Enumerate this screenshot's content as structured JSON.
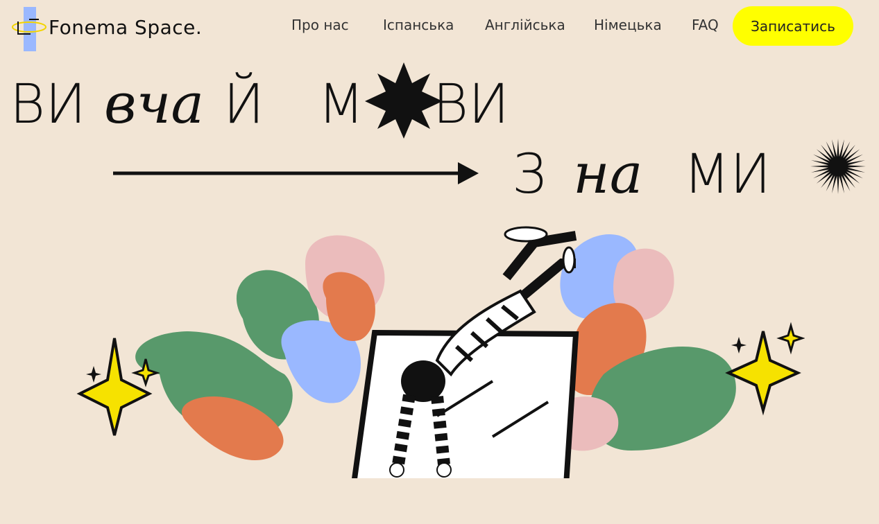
{
  "brand": {
    "name": "Fonema Space.",
    "accent_yellow": "#ffff00",
    "accent_blue": "#9ab8ff"
  },
  "nav": {
    "items": [
      {
        "label": "Про нас"
      },
      {
        "label": "Іспанська"
      },
      {
        "label": "Англійська"
      },
      {
        "label": "Німецька"
      },
      {
        "label": "FAQ"
      }
    ],
    "cta_label": "Записатись"
  },
  "hero": {
    "line1_part_a": "ВИ",
    "line1_part_b": "вча",
    "line1_part_c": "Й",
    "line1_part_d": "М",
    "line1_part_e": "ВИ",
    "line1_part_f": "и",
    "line2_part_a": "З",
    "line2_part_b": "на",
    "line2_part_c": "МИ",
    "icons": [
      "star-burst-icon",
      "sun-burst-icon",
      "arrow-right-icon",
      "sparkle-icon"
    ]
  },
  "illustration": {
    "name": "person-diving-into-laptop-illustration",
    "colors": [
      "#58996b",
      "#e37a4d",
      "#9ab8ff",
      "#ebbcbc"
    ]
  }
}
